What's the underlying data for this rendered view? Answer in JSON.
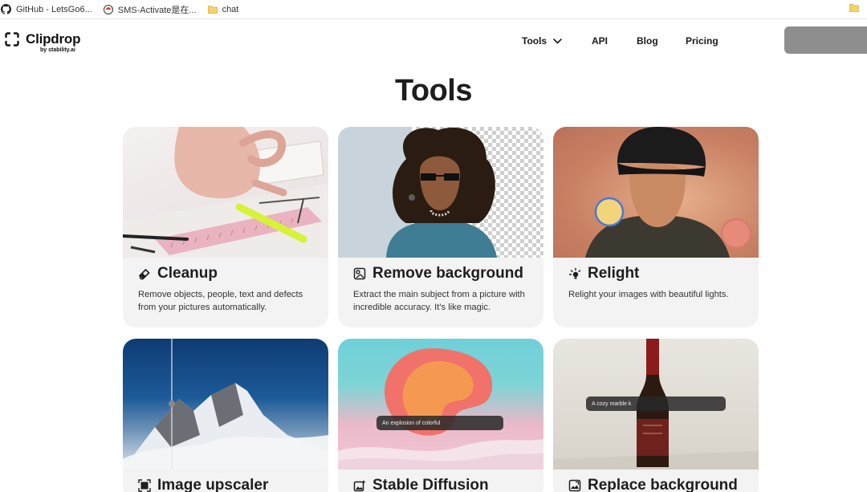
{
  "bookmarks": [
    {
      "label": "GitHub - LetsGo6...",
      "icon": "github-icon"
    },
    {
      "label": "SMS-Activate是在...",
      "icon": "sms-activate-icon"
    },
    {
      "label": "chat",
      "icon": "folder-icon"
    }
  ],
  "brand": {
    "name": "Clipdrop",
    "byline": "by stability.ai"
  },
  "nav": {
    "tools": "Tools",
    "api": "API",
    "blog": "Blog",
    "pricing": "Pricing"
  },
  "page": {
    "title": "Tools"
  },
  "tools": [
    {
      "title": "Cleanup",
      "icon": "eraser-icon",
      "description": "Remove objects, people, text and defects from your pictures automatically."
    },
    {
      "title": "Remove background",
      "icon": "remove-background-icon",
      "description": "Extract the main subject from a picture with incredible accuracy. It's like magic."
    },
    {
      "title": "Relight",
      "icon": "relight-icon",
      "description": "Relight your images with beautiful lights."
    },
    {
      "title": "Image upscaler",
      "icon": "upscaler-icon",
      "description": ""
    },
    {
      "title": "Stable Diffusion",
      "icon": "stable-diffusion-icon",
      "description": "",
      "prompt_preview": "An explosion of colorful"
    },
    {
      "title": "Replace background",
      "icon": "replace-background-icon",
      "description": "",
      "prompt_preview": "A cozy marble k"
    }
  ],
  "colors": {
    "card_bg": "#f3f3f3",
    "text": "#1e1e1e",
    "cta": "#8e8e8e"
  }
}
